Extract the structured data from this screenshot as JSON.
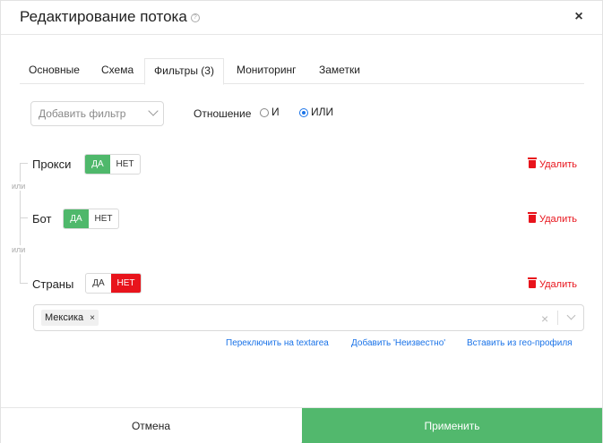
{
  "modal": {
    "title": "Редактирование потока",
    "help_icon": "?",
    "close_icon": "×"
  },
  "tabs": [
    {
      "label": "Основные",
      "active": false
    },
    {
      "label": "Схема",
      "active": false
    },
    {
      "label": "Фильтры (3)",
      "active": true
    },
    {
      "label": "Мониторинг",
      "active": false
    },
    {
      "label": "Заметки",
      "active": false
    }
  ],
  "controls": {
    "add_filter_placeholder": "Добавить фильтр",
    "relation_label": "Отношение",
    "relation_and": "И",
    "relation_or": "ИЛИ",
    "relation_selected": "ИЛИ"
  },
  "connector": "или",
  "filters": [
    {
      "name": "Прокси",
      "yes": "ДА",
      "no": "НЕТ",
      "selected": "yes",
      "delete": "Удалить"
    },
    {
      "name": "Бот",
      "yes": "ДА",
      "no": "НЕТ",
      "selected": "yes",
      "delete": "Удалить"
    },
    {
      "name": "Страны",
      "yes": "ДА",
      "no": "НЕТ",
      "selected": "no",
      "delete": "Удалить"
    }
  ],
  "countries": {
    "chips": [
      "Мексика"
    ],
    "chip_remove": "×",
    "clear": "×"
  },
  "links": {
    "textarea": "Переключить на textarea",
    "unknown": "Добавить 'Неизвестно'",
    "geo": "Вставить из гео-профиля"
  },
  "footer": {
    "cancel": "Отмена",
    "apply": "Применить"
  },
  "colors": {
    "accent_green": "#52b86d",
    "danger_red": "#e8141c",
    "link_blue": "#1a73e8"
  },
  "icons": {
    "close": "close-icon",
    "help": "help-icon",
    "delete": "trash-icon",
    "dropdown": "chevron-down-icon",
    "clear": "clear-icon"
  }
}
